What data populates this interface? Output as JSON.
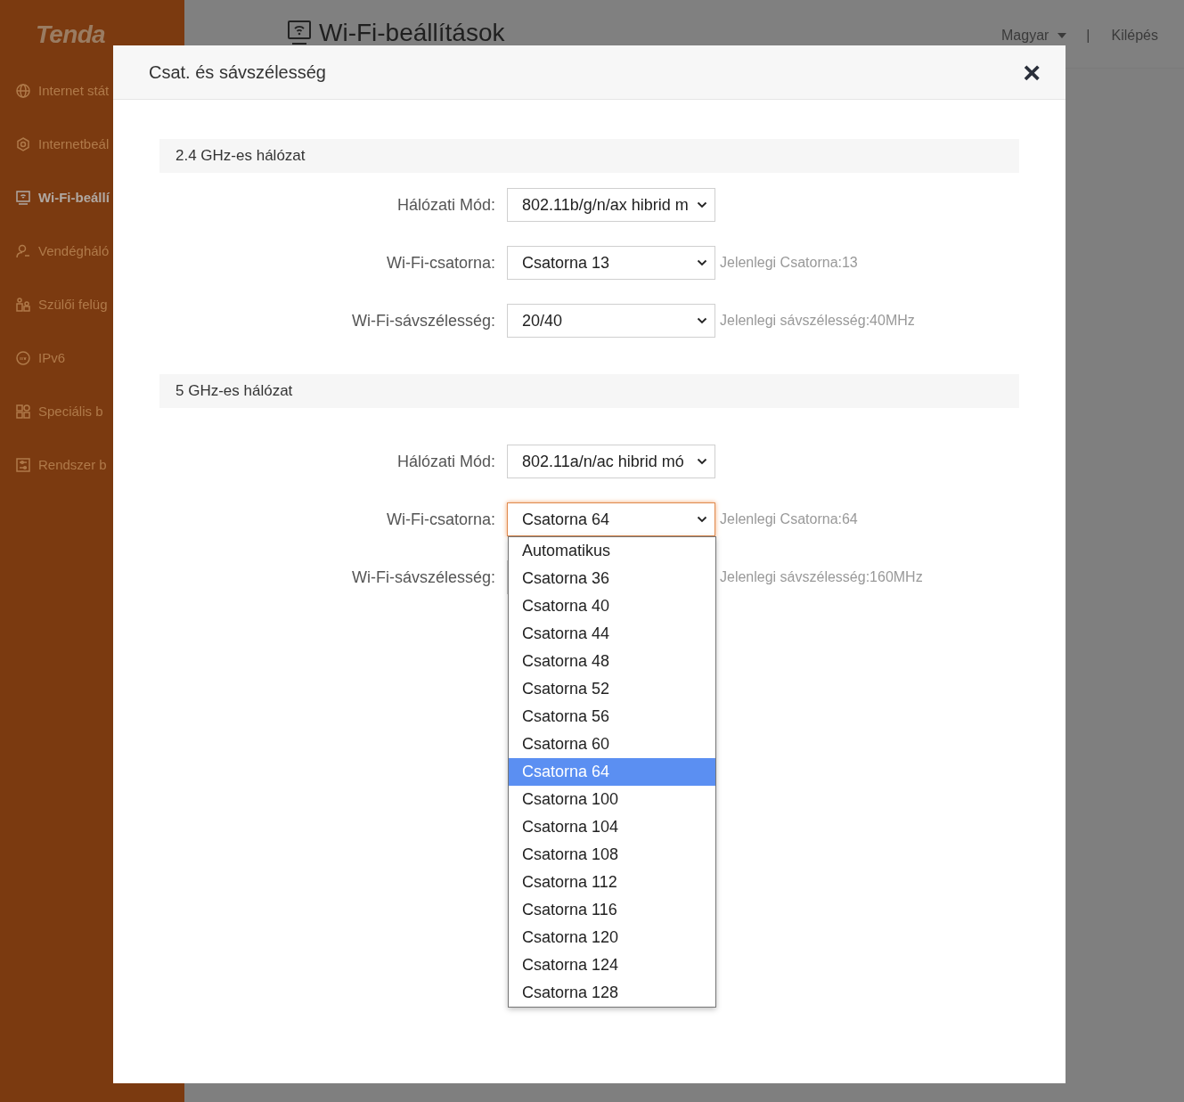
{
  "sidebar": {
    "logo": "Tenda",
    "items": [
      {
        "label": "Internet stát",
        "kind": "globe",
        "selected": false
      },
      {
        "label": "Internetbeál",
        "kind": "hexagon",
        "selected": false
      },
      {
        "label": "Wi-Fi-beállí",
        "kind": "monitor",
        "selected": true
      },
      {
        "label": "Vendégháló",
        "kind": "person",
        "selected": false
      },
      {
        "label": "Szülői felüg",
        "kind": "family",
        "selected": false
      },
      {
        "label": "IPv6",
        "kind": "ipv6",
        "selected": false
      },
      {
        "label": "Speciális b",
        "kind": "grid",
        "selected": false
      },
      {
        "label": "Rendszer b",
        "kind": "sliders",
        "selected": false
      }
    ]
  },
  "header": {
    "title": "Wi-Fi-beállítások",
    "language": "Magyar",
    "separator": "|",
    "logout": "Kilépés"
  },
  "modal": {
    "title": "Csat. és sávszélesség",
    "close": "×",
    "sections": [
      {
        "title": "2.4 GHz-es hálózat",
        "rows": [
          {
            "label": "Hálózati Mód:",
            "value": "802.11b/g/n/ax hibrid m",
            "open": false
          },
          {
            "label": "Wi-Fi-csatorna:",
            "value": "Csatorna 13",
            "hint": "Jelenlegi Csatorna:13",
            "open": false
          },
          {
            "label": "Wi-Fi-sávszélesség:",
            "value": "20/40",
            "hint": "Jelenlegi sávszélesség:40MHz",
            "open": false
          }
        ]
      },
      {
        "title": "5 GHz-es hálózat",
        "rows": [
          {
            "label": "Hálózati Mód:",
            "value": "802.11a/n/ac hibrid mó",
            "open": false
          },
          {
            "label": "Wi-Fi-csatorna:",
            "value": "Csatorna 64",
            "hint": "Jelenlegi Csatorna:64",
            "open": true,
            "options": [
              {
                "label": "Automatikus",
                "selected": false
              },
              {
                "label": "Csatorna 36",
                "selected": false
              },
              {
                "label": "Csatorna 40",
                "selected": false
              },
              {
                "label": "Csatorna 44",
                "selected": false
              },
              {
                "label": "Csatorna 48",
                "selected": false
              },
              {
                "label": "Csatorna 52",
                "selected": false
              },
              {
                "label": "Csatorna 56",
                "selected": false
              },
              {
                "label": "Csatorna 60",
                "selected": false
              },
              {
                "label": "Csatorna 64",
                "selected": true
              },
              {
                "label": "Csatorna 100",
                "selected": false
              },
              {
                "label": "Csatorna 104",
                "selected": false
              },
              {
                "label": "Csatorna 108",
                "selected": false
              },
              {
                "label": "Csatorna 112",
                "selected": false
              },
              {
                "label": "Csatorna 116",
                "selected": false
              },
              {
                "label": "Csatorna 120",
                "selected": false
              },
              {
                "label": "Csatorna 124",
                "selected": false
              },
              {
                "label": "Csatorna 128",
                "selected": false
              }
            ]
          },
          {
            "label": "Wi-Fi-sávszélesség:",
            "hint": "Jelenlegi sávszélesség:160MHz",
            "open": false
          }
        ]
      }
    ]
  }
}
